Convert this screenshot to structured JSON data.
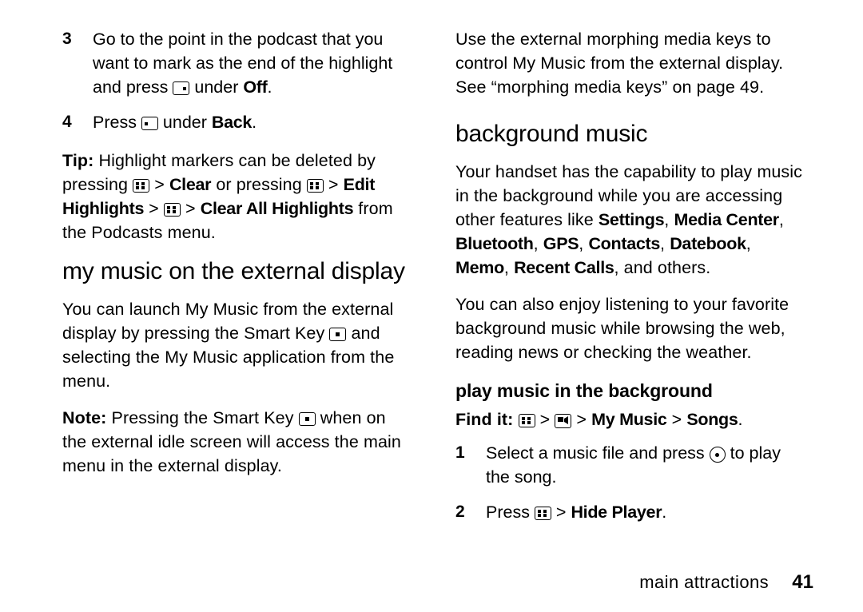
{
  "page": {
    "footer_label": "main attractions",
    "footer_page": "41"
  },
  "left_column": {
    "step3": {
      "num": "3",
      "text_a": "Go to the point in the podcast that you want to mark as the end of the highlight and press ",
      "text_b": " under ",
      "bold_b": "Off",
      "text_c": "."
    },
    "step4": {
      "num": "4",
      "text_a": "Press ",
      "text_b": " under ",
      "bold_b": "Back",
      "text_c": "."
    },
    "tip": {
      "lede": "Tip:",
      "text_a": " Highlight markers can be deleted by pressing ",
      "text_b": " > ",
      "bold_b": "Clear",
      "text_c": " or pressing ",
      "text_d": " > ",
      "bold_d": "Edit Highlights",
      "text_e": " > ",
      "text_f": " > ",
      "bold_f": "Clear All Highlights",
      "text_g": " from the Podcasts menu."
    },
    "heading": "my music on the external display",
    "para1_a": "You can launch My Music from the external display by pressing the Smart Key ",
    "para1_b": " and selecting the My Music application from the menu.",
    "note": {
      "lede": "Note:",
      "text_a": " Pressing the Smart Key ",
      "text_b": " when on the external idle screen will access the main menu in the external display."
    }
  },
  "right_column": {
    "para_top": "Use the external morphing media keys to control My Music from the external display. See “morphing media keys” on page 49.",
    "heading": "background music",
    "para1_a": "Your handset has the capability to play music in the background while you are accessing other features like ",
    "para1_items": [
      "Settings",
      "Media Center",
      "Bluetooth",
      "GPS",
      "Contacts",
      "Datebook",
      "Memo",
      "Recent Calls"
    ],
    "para1_b": ", and others.",
    "para2": "You can also enjoy listening to your favorite background music while browsing the web, reading news or checking the weather.",
    "subheading": "play music in the background",
    "findit": {
      "lede": "Find it:",
      "sep1": " > ",
      "sep2": " > ",
      "item1": "My Music",
      "sep3": " > ",
      "item2": "Songs",
      "period": "."
    },
    "step1": {
      "num": "1",
      "text_a": "Select a music file and press ",
      "text_b": " to play the song."
    },
    "step2": {
      "num": "2",
      "text_a": "Press ",
      "text_b": " > ",
      "bold_b": "Hide Player",
      "text_c": "."
    }
  }
}
